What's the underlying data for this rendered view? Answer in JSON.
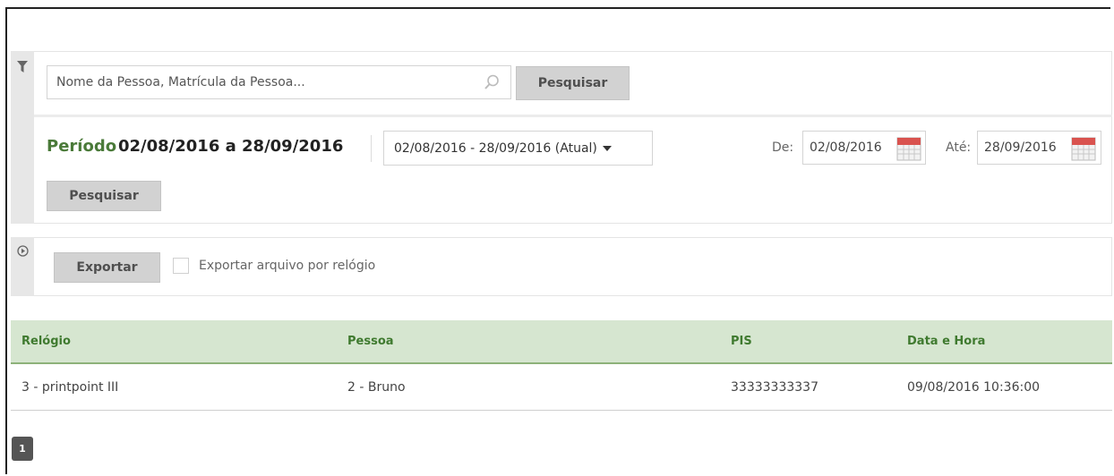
{
  "filter": {
    "search_placeholder": "Nome da Pessoa, Matrícula da Pessoa...",
    "search_button": "Pesquisar",
    "period_label": "Período",
    "period_range": "02/08/2016 a 28/09/2016",
    "period_select": "02/08/2016 - 28/09/2016 (Atual)",
    "from_label": "De:",
    "from_value": "02/08/2016",
    "to_label": "Até:",
    "to_value": "28/09/2016",
    "search_button_2": "Pesquisar"
  },
  "export": {
    "button": "Exportar",
    "checkbox_label": "Exportar arquivo por relógio",
    "checkbox_checked": false
  },
  "table": {
    "columns": [
      "Relógio",
      "Pessoa",
      "PIS",
      "Data e Hora"
    ],
    "rows": [
      [
        "3 - printpoint III",
        "2 - Bruno",
        "33333333337",
        "09/08/2016 10:36:00"
      ]
    ]
  },
  "pagination": {
    "current": "1"
  },
  "colors": {
    "header_bg": "#d6e6d0",
    "header_text": "#3f7a2f",
    "period_label": "#4a7a39",
    "button_bg": "#d2d2d2",
    "calendar_red": "#d9534f"
  },
  "icons": {
    "filter": "funnel-icon",
    "search": "magnifier-icon",
    "calendar": "calendar-icon",
    "export_panel": "play-circle-icon"
  }
}
